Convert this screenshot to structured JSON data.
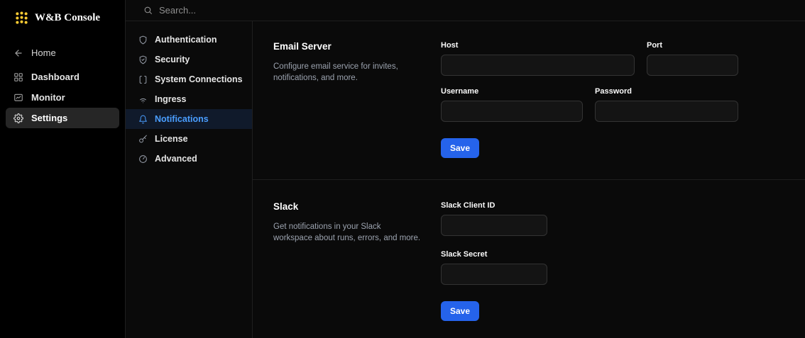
{
  "colors": {
    "accent": "#2563eb",
    "active_link": "#4a9eff",
    "logo_dot": "#ffcc33"
  },
  "brand": {
    "title": "W&B Console"
  },
  "topbar": {
    "search_placeholder": "Search..."
  },
  "sidebar": {
    "items": [
      {
        "label": "Home",
        "icon": "arrow-left-icon",
        "active": false
      },
      {
        "label": "Dashboard",
        "icon": "grid-icon",
        "active": false
      },
      {
        "label": "Monitor",
        "icon": "monitor-icon",
        "active": false
      },
      {
        "label": "Settings",
        "icon": "gear-icon",
        "active": true
      }
    ]
  },
  "settings_nav": {
    "items": [
      {
        "label": "Authentication",
        "icon": "shield-icon",
        "active": false
      },
      {
        "label": "Security",
        "icon": "shield-check-icon",
        "active": false
      },
      {
        "label": "System Connections",
        "icon": "brackets-icon",
        "active": false
      },
      {
        "label": "Ingress",
        "icon": "wifi-icon",
        "active": false
      },
      {
        "label": "Notifications",
        "icon": "bell-icon",
        "active": true
      },
      {
        "label": "License",
        "icon": "key-icon",
        "active": false
      },
      {
        "label": "Advanced",
        "icon": "gauge-icon",
        "active": false
      }
    ]
  },
  "email": {
    "title": "Email Server",
    "description": "Configure email service for invites, notifications, and more.",
    "host_label": "Host",
    "host_value": "",
    "port_label": "Port",
    "port_value": "",
    "username_label": "Username",
    "username_value": "",
    "password_label": "Password",
    "password_value": "",
    "save_label": "Save"
  },
  "slack": {
    "title": "Slack",
    "description": "Get notifications in your Slack workspace about runs, errors, and more.",
    "client_id_label": "Slack Client ID",
    "client_id_value": "",
    "secret_label": "Slack Secret",
    "secret_value": "",
    "save_label": "Save"
  }
}
